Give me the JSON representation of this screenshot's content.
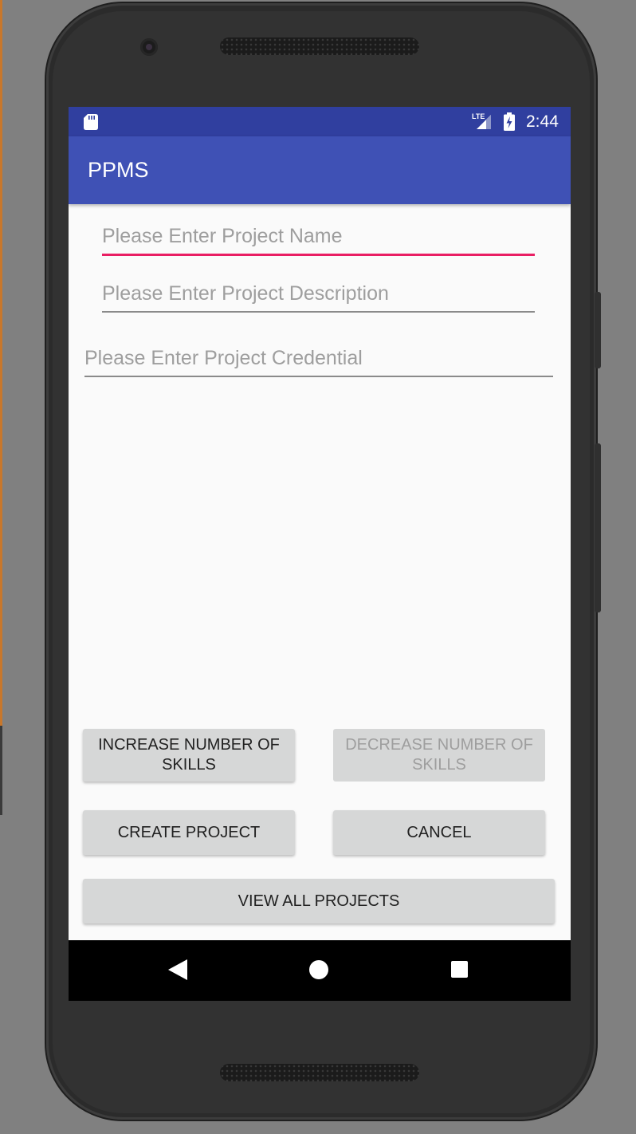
{
  "status_bar": {
    "time": "2:44",
    "network_label": "LTE",
    "icons": [
      "sd-card-icon",
      "lte-signal-icon",
      "battery-charging-icon"
    ],
    "color": "#303f9f"
  },
  "app_bar": {
    "title": "PPMS",
    "color": "#3f51b5"
  },
  "form": {
    "project_name": {
      "value": "",
      "placeholder": "Please Enter Project Name",
      "focused": true
    },
    "project_description": {
      "value": "",
      "placeholder": "Please Enter Project Description"
    },
    "project_credential": {
      "value": "",
      "placeholder": "Please Enter Project Credential"
    }
  },
  "buttons": {
    "increase_skills": "INCREASE NUMBER OF SKILLS",
    "decrease_skills": "DECREASE NUMBER OF SKILLS",
    "decrease_skills_enabled": false,
    "create_project": "CREATE PROJECT",
    "cancel": "CANCEL",
    "view_all_projects": "VIEW ALL PROJECTS"
  },
  "nav_bar": {
    "icons": [
      "back-icon",
      "home-icon",
      "recents-icon"
    ]
  },
  "colors": {
    "accent": "#e91e63",
    "button_bg": "#d6d7d7",
    "screen_bg": "#fafafa"
  }
}
